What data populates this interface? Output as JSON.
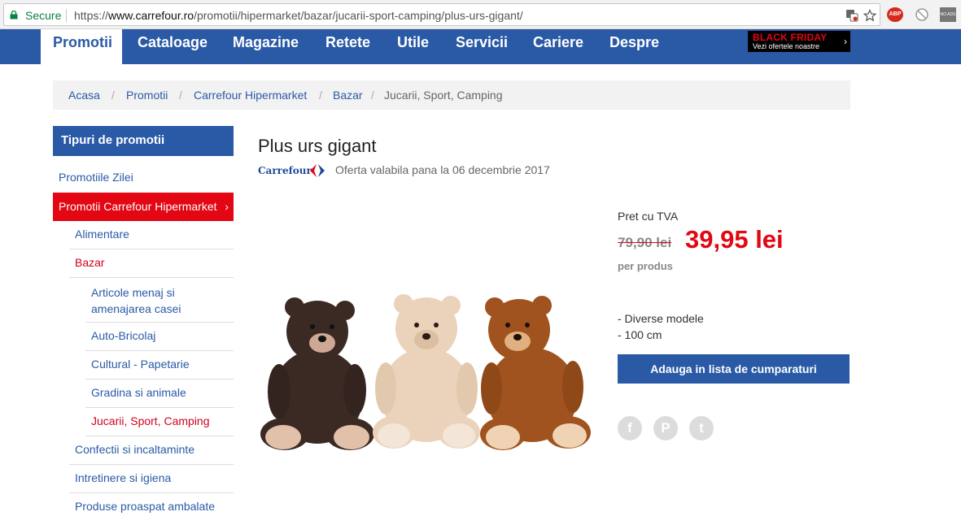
{
  "browser": {
    "secure_label": "Secure",
    "url_scheme": "https://",
    "url_host": "www.carrefour.ro",
    "url_path": "/promotii/hipermarket/bazar/jucarii-sport-camping/plus-urs-gigant/",
    "extensions": [
      {
        "name": "adblock-plus-icon",
        "label": "ABP"
      },
      {
        "name": "blocker-icon",
        "label": ""
      },
      {
        "name": "no-ads-icon",
        "label": "NO ADS"
      }
    ]
  },
  "nav": {
    "items": [
      "Promotii",
      "Cataloage",
      "Magazine",
      "Retete",
      "Utile",
      "Servicii",
      "Cariere",
      "Despre"
    ],
    "active": "Promotii",
    "banner": {
      "title": "BLACK FRIDAY",
      "subtitle": "Vezi ofertele noastre",
      "arrow": "›"
    }
  },
  "breadcrumb": {
    "items": [
      "Acasa",
      "Promotii",
      "Carrefour Hipermarket",
      "Bazar",
      "Jucarii, Sport, Camping"
    ],
    "separator": "/"
  },
  "sidebar": {
    "heading": "Tipuri de promotii",
    "items": [
      {
        "label": "Promotiile Zilei",
        "level": 1
      },
      {
        "label": "Promotii Carrefour Hipermarket",
        "level": 1,
        "active": true,
        "chevron": "›"
      },
      {
        "label": "Alimentare",
        "level": 2
      },
      {
        "label": "Bazar",
        "level": 2,
        "selected": true
      },
      {
        "label": "Articole menaj si amenajarea casei",
        "level": 3
      },
      {
        "label": "Auto-Bricolaj",
        "level": 3
      },
      {
        "label": "Cultural - Papetarie",
        "level": 3
      },
      {
        "label": "Gradina si animale",
        "level": 3
      },
      {
        "label": "Jucarii, Sport, Camping",
        "level": 3,
        "selected": true
      },
      {
        "label": "Confectii si incaltaminte",
        "level": 2
      },
      {
        "label": "Intretinere si igiena",
        "level": 2
      },
      {
        "label": "Produse proaspat ambalate",
        "level": 2
      }
    ]
  },
  "product": {
    "title": "Plus urs gigant",
    "brand": "Carrefour",
    "offer_text": "Oferta valabila pana la 06 decembrie 2017",
    "price_label": "Pret cu TVA",
    "old_price": "79,90 lei",
    "new_price": "39,95 lei",
    "unit": "per produs",
    "details": [
      "- Diverse modele",
      "- 100 cm"
    ],
    "add_button": "Adauga in lista de cumparaturi",
    "share": [
      {
        "name": "facebook-share-icon",
        "glyph": "f"
      },
      {
        "name": "pinterest-share-icon",
        "glyph": "P"
      },
      {
        "name": "twitter-share-icon",
        "glyph": "t"
      }
    ],
    "image_alt": "three teddy bears: dark brown, beige, brown"
  },
  "colors": {
    "brand_blue": "#2a5aa6",
    "accent_red": "#e30613"
  }
}
